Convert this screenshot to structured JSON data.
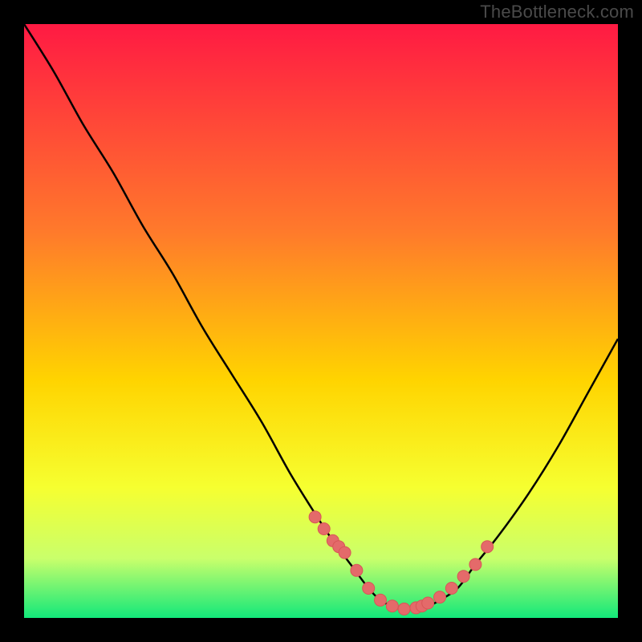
{
  "attribution": "TheBottleneck.com",
  "colors": {
    "bg": "#000000",
    "gradient_top": "#ff1a43",
    "gradient_mid1": "#ff7a2b",
    "gradient_mid2": "#ffd400",
    "gradient_mid3": "#f6ff30",
    "gradient_mid4": "#c9ff6b",
    "gradient_bottom": "#12e87a",
    "curve": "#000000",
    "marker_fill": "#e46a6a",
    "marker_stroke": "#d85656"
  },
  "chart_data": {
    "type": "line",
    "title": "",
    "xlabel": "",
    "ylabel": "",
    "x": [
      0,
      5,
      10,
      15,
      20,
      25,
      30,
      35,
      40,
      45,
      50,
      52,
      55,
      58,
      60,
      62,
      65,
      68,
      70,
      73,
      76,
      80,
      85,
      90,
      95,
      100
    ],
    "y": [
      100,
      92,
      83,
      75,
      66,
      58,
      49,
      41,
      33,
      24,
      16,
      13,
      9,
      5,
      3,
      2,
      1.5,
      2,
      3,
      5,
      9,
      14,
      21,
      29,
      38,
      47
    ],
    "xlim": [
      0,
      100
    ],
    "ylim": [
      0,
      100
    ],
    "markers": {
      "x": [
        49,
        50.5,
        52,
        53,
        54,
        56,
        58,
        60,
        62,
        64,
        66,
        67,
        68,
        70,
        72,
        74,
        76,
        78
      ],
      "y": [
        17,
        15,
        13,
        12,
        11,
        8,
        5,
        3,
        2,
        1.5,
        1.7,
        2,
        2.5,
        3.5,
        5,
        7,
        9,
        12
      ]
    }
  }
}
